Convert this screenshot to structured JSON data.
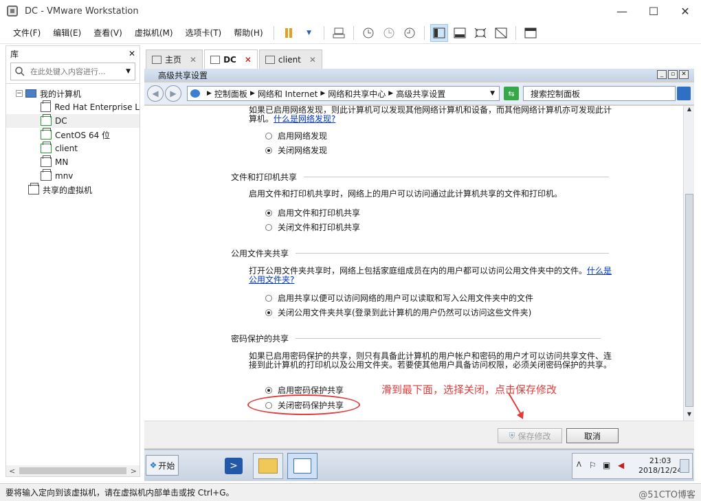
{
  "window": {
    "title": "DC - VMware Workstation",
    "controls": [
      "—",
      "☐",
      "✕"
    ]
  },
  "menu": [
    "文件(F)",
    "编辑(E)",
    "查看(V)",
    "虚拟机(M)",
    "选项卡(T)",
    "帮助(H)"
  ],
  "library": {
    "title": "库",
    "close": "✕",
    "search_placeholder": "在此处键入内容进行...",
    "tree_root": "我的计算机",
    "vms": [
      "Red Hat Enterprise L",
      "DC",
      "CentOS 64 位",
      "client",
      "MN",
      "mnv"
    ],
    "shared": "共享的虚拟机"
  },
  "tabs": [
    {
      "label": "主页"
    },
    {
      "label": "DC"
    },
    {
      "label": "client"
    }
  ],
  "guest": {
    "window_title": "高级共享设置",
    "breadcrumb": [
      "控制面板",
      "网络和 Internet",
      "网络和共享中心",
      "高级共享设置"
    ],
    "search_placeholder": "搜索控制面板",
    "discovery_text": "如果已启用网络发现，则此计算机可以发现其他网络计算机和设备，而其他网络计算机亦可发现此计算机。",
    "discovery_link": "什么是网络发现?",
    "discovery_on": "启用网络发现",
    "discovery_off": "关闭网络发现",
    "file_section": "文件和打印机共享",
    "file_text": "启用文件和打印机共享时，网络上的用户可以访问通过此计算机共享的文件和打印机。",
    "file_on": "启用文件和打印机共享",
    "file_off": "关闭文件和打印机共享",
    "public_section": "公用文件夹共享",
    "public_text": "打开公用文件夹共享时，网络上包括家庭组成员在内的用户都可以访问公用文件夹中的文件。",
    "public_link": "什么是公用文件夹?",
    "public_on": "启用共享以便可以访问网络的用户可以读取和写入公用文件夹中的文件",
    "public_off": "关闭公用文件夹共享(登录到此计算机的用户仍然可以访问这些文件夹)",
    "password_section": "密码保护的共享",
    "password_text": "如果已启用密码保护的共享，则只有具备此计算机的用户帐户和密码的用户才可以访问共享文件、连接到此计算机的打印机以及公用文件夹。若要使其他用户具备访问权限，必须关闭密码保护的共享。",
    "password_on": "启用密码保护共享",
    "password_off": "关闭密码保护共享",
    "save_button": "保存修改",
    "cancel_button": "取消",
    "annotation": "滑到最下面，选择关闭，点击保存修改",
    "start_label": "开始",
    "clock_time": "21:03",
    "clock_date": "2018/12/24"
  },
  "status": {
    "text": "要将输入定向到该虚拟机，请在虚拟机内部单击或按 Ctrl+G。",
    "watermark": "@51CTO博客"
  },
  "colors": {
    "annotation": "#e03c3c",
    "link": "#0033cc"
  }
}
